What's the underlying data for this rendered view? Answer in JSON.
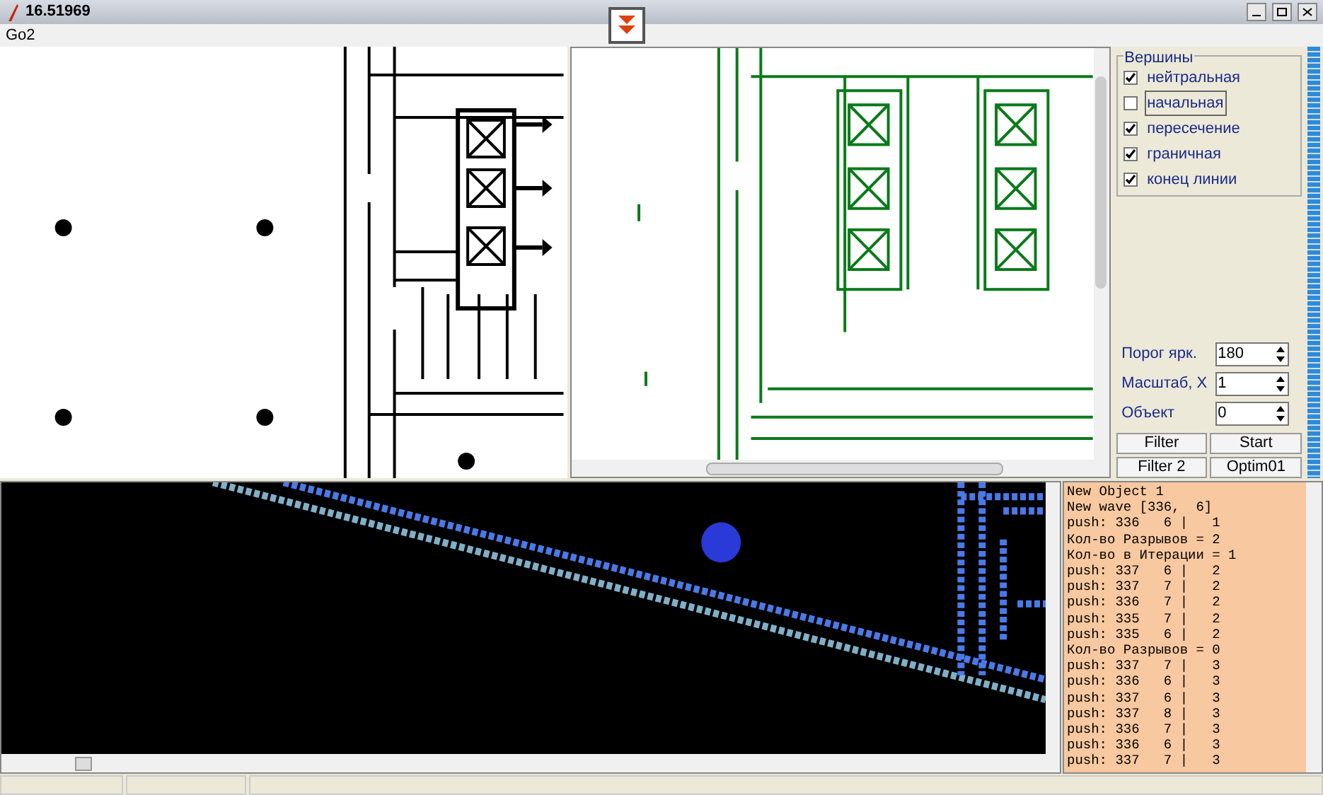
{
  "window": {
    "title": "16.51969"
  },
  "menu": [
    "Go2"
  ],
  "vertices": {
    "title": "Вершины",
    "items": [
      {
        "label": "нейтральная",
        "checked": true,
        "selected": false
      },
      {
        "label": "начальная",
        "checked": false,
        "selected": true
      },
      {
        "label": "пересечение",
        "checked": true,
        "selected": false
      },
      {
        "label": "граничная",
        "checked": true,
        "selected": false
      },
      {
        "label": "конец линии",
        "checked": true,
        "selected": false
      }
    ]
  },
  "fields": [
    {
      "label": "Порог ярк.",
      "value": "180"
    },
    {
      "label": "Масштаб, X",
      "value": "1"
    },
    {
      "label": "Объект",
      "value": "0"
    }
  ],
  "buttons": [
    "Filter",
    "Start",
    "Filter 2",
    "Optim01"
  ],
  "log": [
    "New Object 1",
    "New wave [336,  6]",
    "push: 336   6 |   1",
    "Кол-во Разрывов = 2",
    "Кол-во в Итерации = 1",
    "push: 337   6 |   2",
    "push: 337   7 |   2",
    "push: 336   7 |   2",
    "push: 335   7 |   2",
    "push: 335   6 |   2",
    "Кол-во Разрывов = 0",
    "push: 337   7 |   3",
    "push: 336   6 |   3",
    "push: 337   6 |   3",
    "push: 337   8 |   3",
    "push: 336   7 |   3",
    "push: 336   6 |   3",
    "push: 337   7 |   3"
  ]
}
